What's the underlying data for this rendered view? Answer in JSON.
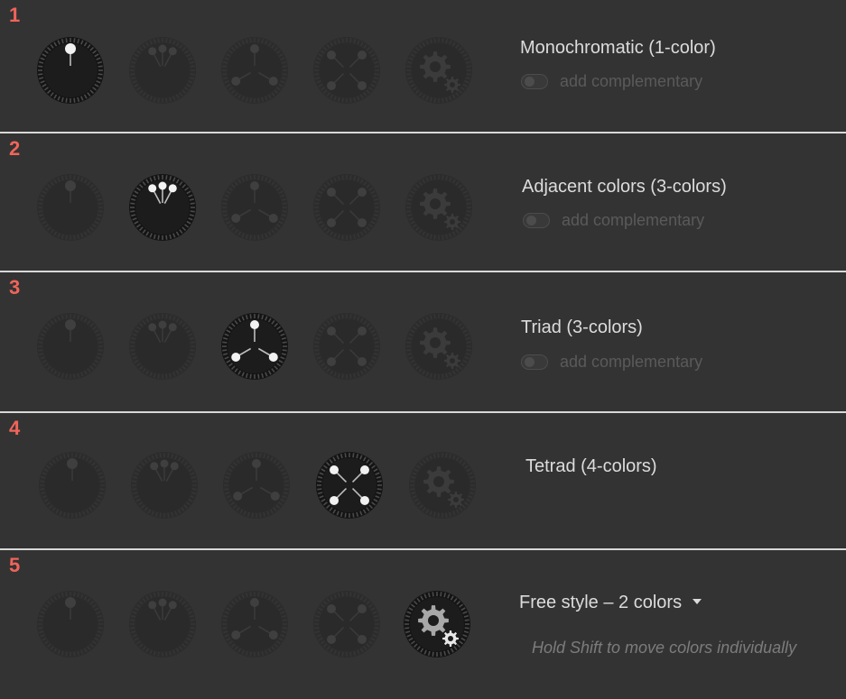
{
  "colors": {
    "accent_number": "#f0645a",
    "panel_bg": "#333333",
    "divider": "#d8d8d8",
    "label_text": "#dcdcdc",
    "muted_text": "#5a5a5a",
    "hint_text": "#7c7c7c"
  },
  "wheel_types": [
    {
      "id": "mono",
      "icon": "monochromatic-wheel-icon"
    },
    {
      "id": "adjacent",
      "icon": "adjacent-wheel-icon"
    },
    {
      "id": "triad",
      "icon": "triad-wheel-icon"
    },
    {
      "id": "tetrad",
      "icon": "tetrad-wheel-icon"
    },
    {
      "id": "free",
      "icon": "gear-wheel-icon"
    }
  ],
  "rows": [
    {
      "number": "1",
      "active_wheel": 0,
      "label": "Monochromatic (1-color)",
      "complementary": "add complementary"
    },
    {
      "number": "2",
      "active_wheel": 1,
      "label": "Adjacent colors (3-colors)",
      "complementary": "add complementary"
    },
    {
      "number": "3",
      "active_wheel": 2,
      "label": "Triad (3-colors)",
      "complementary": "add complementary"
    },
    {
      "number": "4",
      "active_wheel": 3,
      "label": "Tetrad (4-colors)"
    },
    {
      "number": "5",
      "active_wheel": 4,
      "label": "Free style – 2 colors",
      "hint": "Hold Shift to move colors individually"
    }
  ]
}
